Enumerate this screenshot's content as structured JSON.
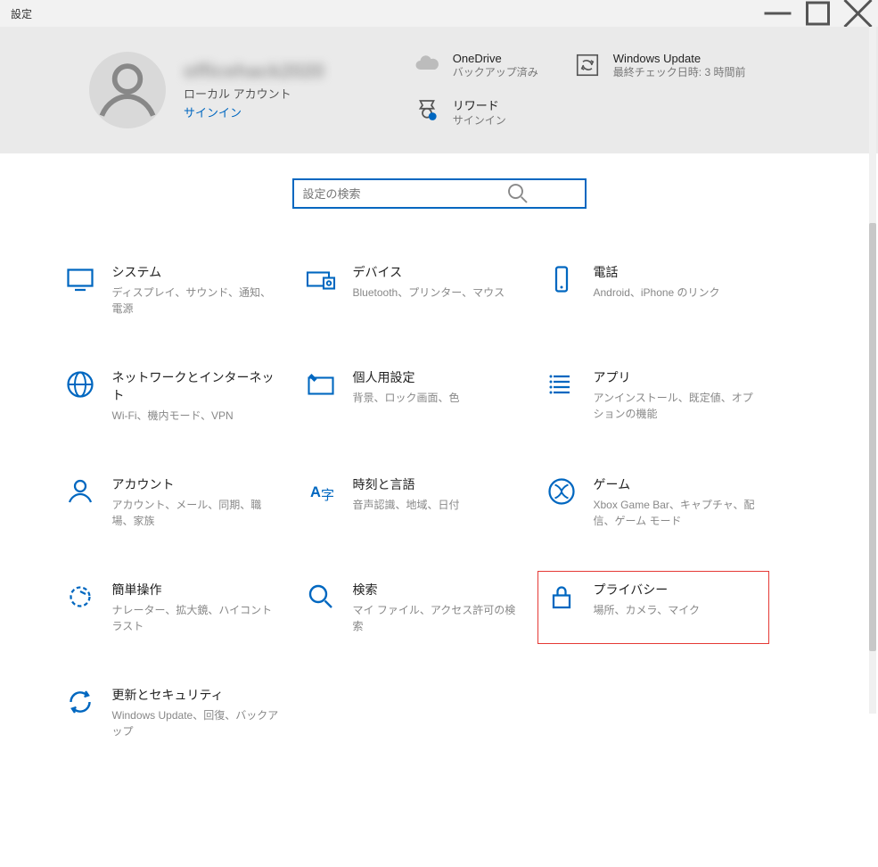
{
  "window": {
    "title": "設定"
  },
  "header": {
    "user": {
      "name_blurred": "officehack2020",
      "account_type": "ローカル アカウント",
      "signin": "サインイン"
    },
    "tiles": {
      "onedrive": {
        "title": "OneDrive",
        "sub": "バックアップ済み"
      },
      "rewards": {
        "title": "リワード",
        "sub": "サインイン"
      },
      "update": {
        "title": "Windows Update",
        "sub": "最終チェック日時: 3 時間前"
      }
    }
  },
  "search": {
    "placeholder": "設定の検索"
  },
  "categories": {
    "system": {
      "title": "システム",
      "sub": "ディスプレイ、サウンド、通知、電源"
    },
    "devices": {
      "title": "デバイス",
      "sub": "Bluetooth、プリンター、マウス"
    },
    "phone": {
      "title": "電話",
      "sub": "Android、iPhone のリンク"
    },
    "network": {
      "title": "ネットワークとインターネット",
      "sub": "Wi-Fi、機内モード、VPN"
    },
    "personalization": {
      "title": "個人用設定",
      "sub": "背景、ロック画面、色"
    },
    "apps": {
      "title": "アプリ",
      "sub": "アンインストール、既定値、オプションの機能"
    },
    "accounts": {
      "title": "アカウント",
      "sub": "アカウント、メール、同期、職場、家族"
    },
    "time": {
      "title": "時刻と言語",
      "sub": "音声認識、地域、日付"
    },
    "gaming": {
      "title": "ゲーム",
      "sub": "Xbox Game Bar、キャプチャ、配信、ゲーム モード"
    },
    "ease": {
      "title": "簡単操作",
      "sub": "ナレーター、拡大鏡、ハイコントラスト"
    },
    "search_cat": {
      "title": "検索",
      "sub": "マイ ファイル、アクセス許可の検索"
    },
    "privacy": {
      "title": "プライバシー",
      "sub": "場所、カメラ、マイク"
    },
    "update_sec": {
      "title": "更新とセキュリティ",
      "sub": "Windows Update、回復、バックアップ"
    }
  }
}
